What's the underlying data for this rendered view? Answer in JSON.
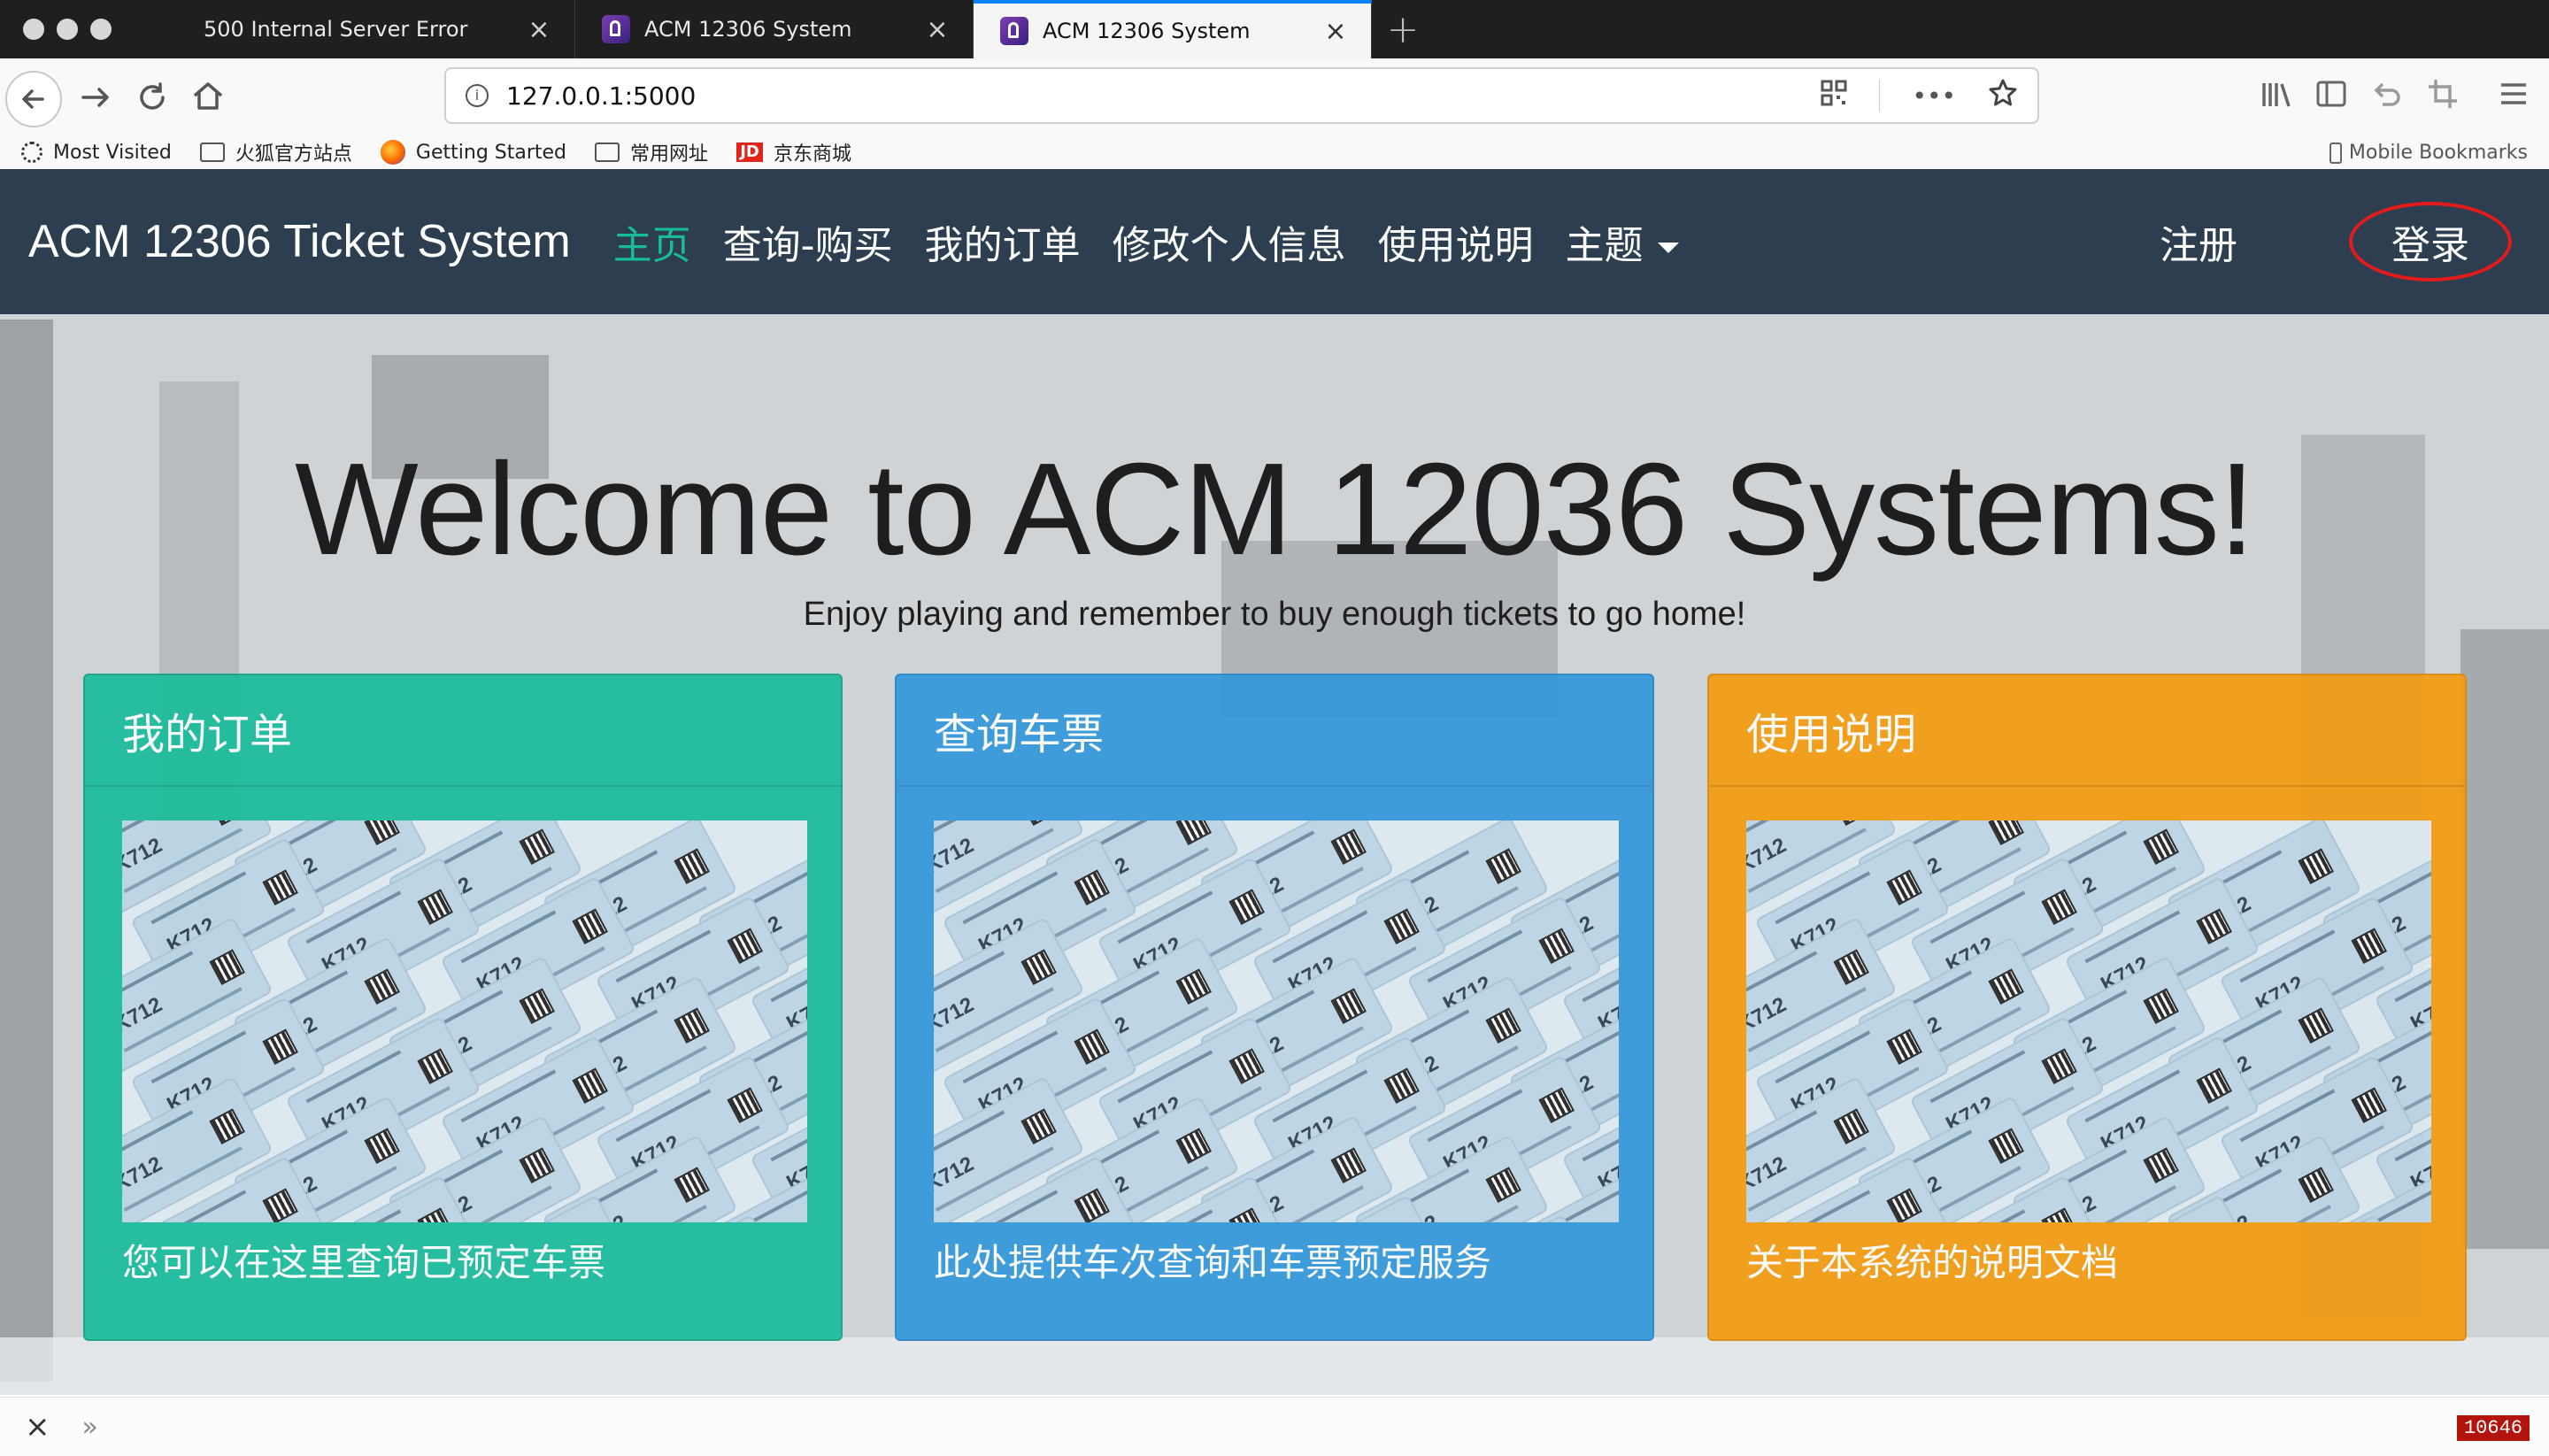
{
  "browser": {
    "tabs": [
      {
        "title": "500 Internal Server Error",
        "active": false
      },
      {
        "title": "ACM 12306 System",
        "active": false
      },
      {
        "title": "ACM 12306 System",
        "active": true
      }
    ],
    "url": "127.0.0.1:5000",
    "bookmarks": [
      "Most Visited",
      "火狐官方站点",
      "Getting Started",
      "常用网址",
      "京东商城"
    ],
    "bookmark_jd_logo": "JD",
    "mobile_bookmarks": "Mobile Bookmarks",
    "status_counter": "10646"
  },
  "site": {
    "brand": "ACM 12306 Ticket System",
    "nav": [
      "主页",
      "查询-购买",
      "我的订单",
      "修改个人信息",
      "使用说明",
      "主题"
    ],
    "register": "注册",
    "login": "登录",
    "hero_title": "Welcome to ACM 12036 Systems!",
    "hero_subtitle": "Enjoy playing and remember to buy enough tickets to go home!",
    "cards": [
      {
        "title": "我的订单",
        "text": "您可以在这里查询已预定车票",
        "color": "#1abc9c"
      },
      {
        "title": "查询车票",
        "text": "此处提供车次查询和车票预定服务",
        "color": "#3498db"
      },
      {
        "title": "使用说明",
        "text": "关于本系统的说明文档",
        "color": "#f39c12"
      }
    ],
    "ticket_code": "K712"
  },
  "colors": {
    "navbar": "#2c3e50",
    "accent": "#18bc9c",
    "login_ring": "#e41b1b"
  }
}
